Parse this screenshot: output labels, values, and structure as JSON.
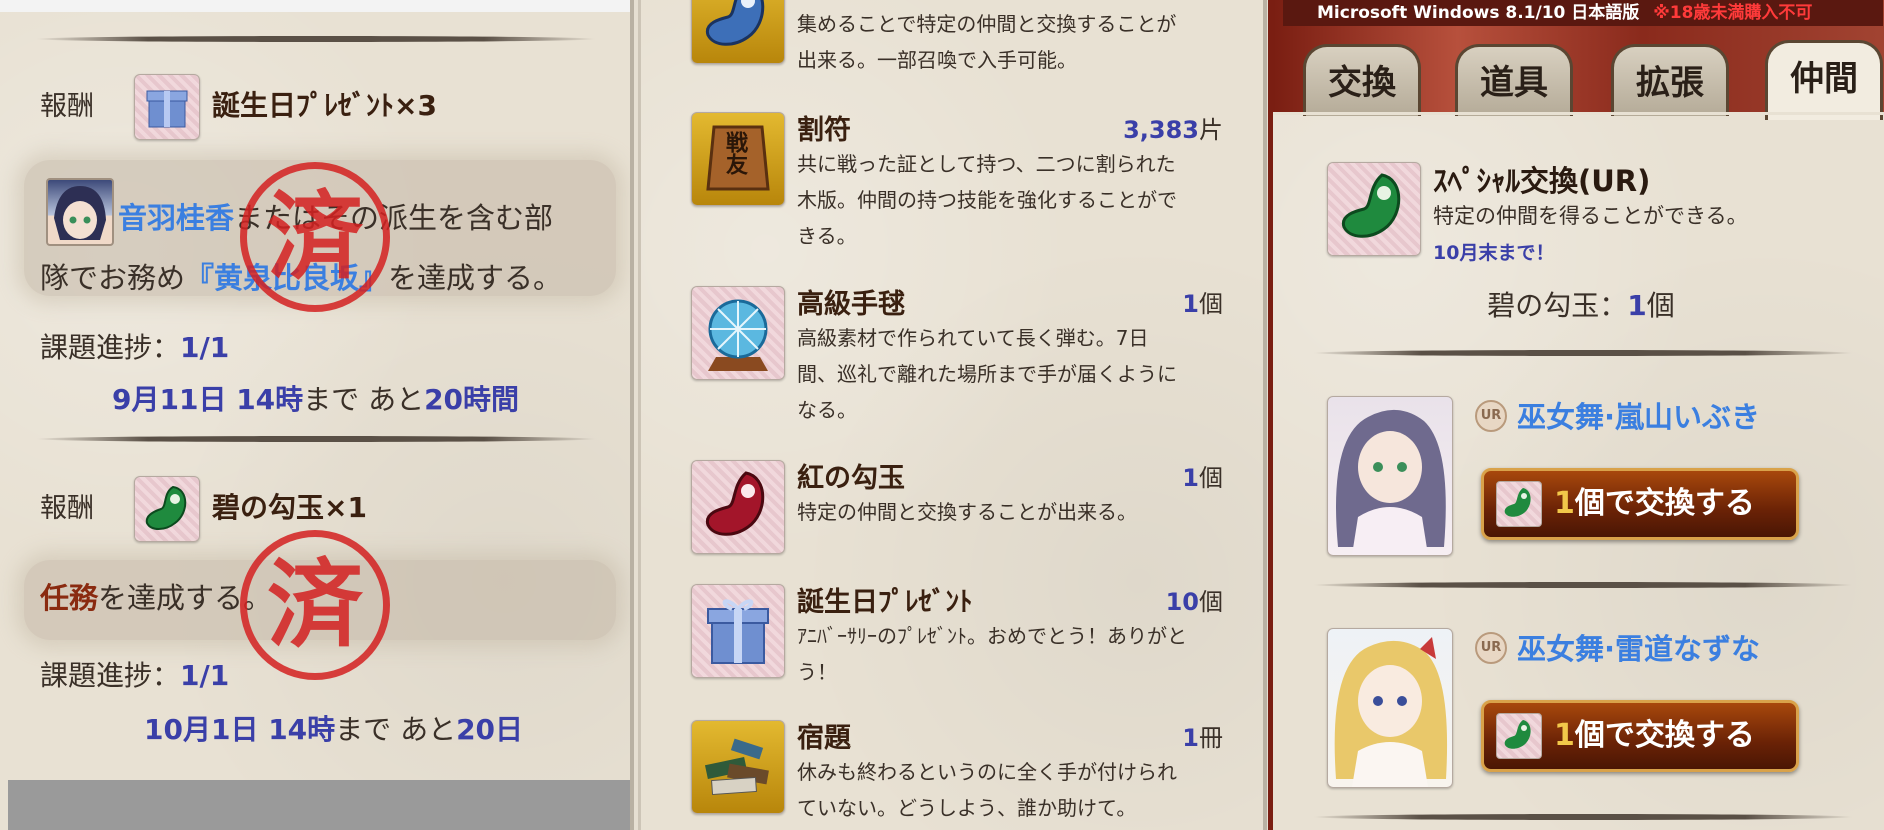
{
  "missions": [
    {
      "reward_label": "報酬",
      "reward_item": "誕生日ﾌﾟﾚｾﾞﾝﾄ×3",
      "char_name": "音羽桂香",
      "text_mid": "またはその派生を含む部",
      "text2_pre": "隊でお務め",
      "quest_name": "『黄泉比良坂』",
      "text_end": "を達成する。",
      "stamp": "済",
      "progress_label": "課題進捗：",
      "progress_value": "1/1",
      "deadline_date": "9月11日 14時",
      "deadline_mid": "まで あと",
      "deadline_remain": "20時間"
    },
    {
      "reward_label": "報酬",
      "reward_item": "碧の勾玉×1",
      "task_word": "任務",
      "task_rest": "を達成する。",
      "stamp": "済",
      "progress_label": "課題進捗：",
      "progress_value": "1/1",
      "deadline_date": "10月1日 14時",
      "deadline_mid": "まで あと",
      "deadline_remain": "20日"
    }
  ],
  "items": [
    {
      "name": "",
      "count": "",
      "unit": "",
      "desc_lines": [
        "集めることで特定の仲間と交換することが",
        "出来る。一部召喚で入手可能。"
      ],
      "icon": "blue-magatama-icon"
    },
    {
      "name": "割符",
      "count": "3,383",
      "unit": "片",
      "desc_lines": [
        "共に戦った証として持つ、二つに割られた",
        "木版。仲間の持つ技能を強化することがで",
        "きる。"
      ],
      "icon": "tally-tablet-icon",
      "icon_text": "戦友"
    },
    {
      "name": "高級手毬",
      "count": "1",
      "unit": "個",
      "desc_lines": [
        "高級素材で作られていて長く弾む。7日",
        "間、巡礼で離れた場所まで手が届くように",
        "なる。"
      ],
      "icon": "temari-ball-icon"
    },
    {
      "name": "紅の勾玉",
      "count": "1",
      "unit": "個",
      "desc_lines": [
        "特定の仲間と交換することが出来る。"
      ],
      "icon": "red-magatama-icon"
    },
    {
      "name": "誕生日ﾌﾟﾚｾﾞﾝﾄ",
      "count": "10",
      "unit": "個",
      "desc_lines": [
        "ｱﾆﾊﾞｰｻﾘｰのﾌﾟﾚｾﾞﾝﾄ。おめでとう！ありがと",
        "う！"
      ],
      "icon": "gift-box-icon"
    },
    {
      "name": "宿題",
      "count": "1",
      "unit": "冊",
      "desc_lines": [
        "休みも終わるというのに全く手が付けられ",
        "ていない。どうしよう、誰か助けて。"
      ],
      "icon": "homework-books-icon"
    }
  ],
  "shop": {
    "banner_text": "Microsoft Windows 8.1/10 日本語版",
    "banner_warning": "※18歳未満購入不可",
    "tabs": [
      "交換",
      "道具",
      "拡張",
      "仲間"
    ],
    "active_tab": "仲間",
    "special_title": "ｽﾍﾟｼｬﾙ交換(UR)",
    "special_desc": "特定の仲間を得ることができる。",
    "special_deadline": "10月末まで！",
    "stock_label": "碧の勾玉：",
    "stock_count": "1",
    "stock_unit": "個",
    "offers": [
      {
        "rarity": "UR",
        "name": "巫女舞·嵐山いぶき",
        "btn_count": "1",
        "btn_label": "個で交換する",
        "hair": "#6f6a8e"
      },
      {
        "rarity": "UR",
        "name": "巫女舞·雷道なずな",
        "btn_count": "1",
        "btn_label": "個で交換する",
        "hair": "#e9c86a"
      }
    ]
  },
  "colors": {
    "accent_blue": "#3a3fa8",
    "link_blue": "#3b7fe0",
    "stamp_red": "#d42121",
    "button_brown": "#6a2206"
  }
}
